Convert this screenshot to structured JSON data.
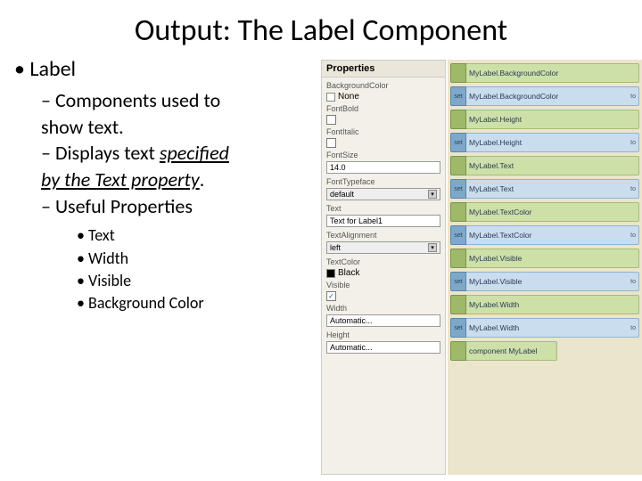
{
  "title": "Output: The Label Component",
  "l1": "Label",
  "sub1a": "Components used to",
  "sub1b": "show text.",
  "sub2a": "Displays text ",
  "sub2b": "specified",
  "sub2c": "by the Text property",
  "sub2d": ".",
  "sub3": "Useful Properties",
  "props_list": [
    "Text",
    "Width",
    "Visible",
    "Background Color"
  ],
  "panel": {
    "header": "Properties",
    "bgcolor_label": "BackgroundColor",
    "bgcolor_val": "None",
    "fontbold": "FontBold",
    "fontitalic": "FontItalic",
    "fontsize_label": "FontSize",
    "fontsize_val": "14.0",
    "typeface_label": "FontTypeface",
    "typeface_val": "default",
    "text_label": "Text",
    "text_val": "Text for Label1",
    "align_label": "TextAlignment",
    "align_val": "left",
    "textcolor_label": "TextColor",
    "textcolor_val": "Black",
    "visible_label": "Visible",
    "width_label": "Width",
    "width_val": "Automatic...",
    "height_label": "Height",
    "height_val": "Automatic..."
  },
  "blocks": [
    {
      "kind": "green",
      "text": "MyLabel.BackgroundColor",
      "to": false
    },
    {
      "kind": "blue",
      "text": "MyLabel.BackgroundColor",
      "to": true
    },
    {
      "kind": "green",
      "text": "MyLabel.Height",
      "to": false
    },
    {
      "kind": "blue",
      "text": "MyLabel.Height",
      "to": true
    },
    {
      "kind": "green",
      "text": "MyLabel.Text",
      "to": false
    },
    {
      "kind": "blue",
      "text": "MyLabel.Text",
      "to": true
    },
    {
      "kind": "green",
      "text": "MyLabel.TextColor",
      "to": false
    },
    {
      "kind": "blue",
      "text": "MyLabel.TextColor",
      "to": true
    },
    {
      "kind": "green",
      "text": "MyLabel.Visible",
      "to": false
    },
    {
      "kind": "blue",
      "text": "MyLabel.Visible",
      "to": true
    },
    {
      "kind": "green",
      "text": "MyLabel.Width",
      "to": false
    },
    {
      "kind": "blue",
      "text": "MyLabel.Width",
      "to": true
    },
    {
      "kind": "green",
      "text": "component MyLabel",
      "to": false,
      "short": true
    }
  ]
}
